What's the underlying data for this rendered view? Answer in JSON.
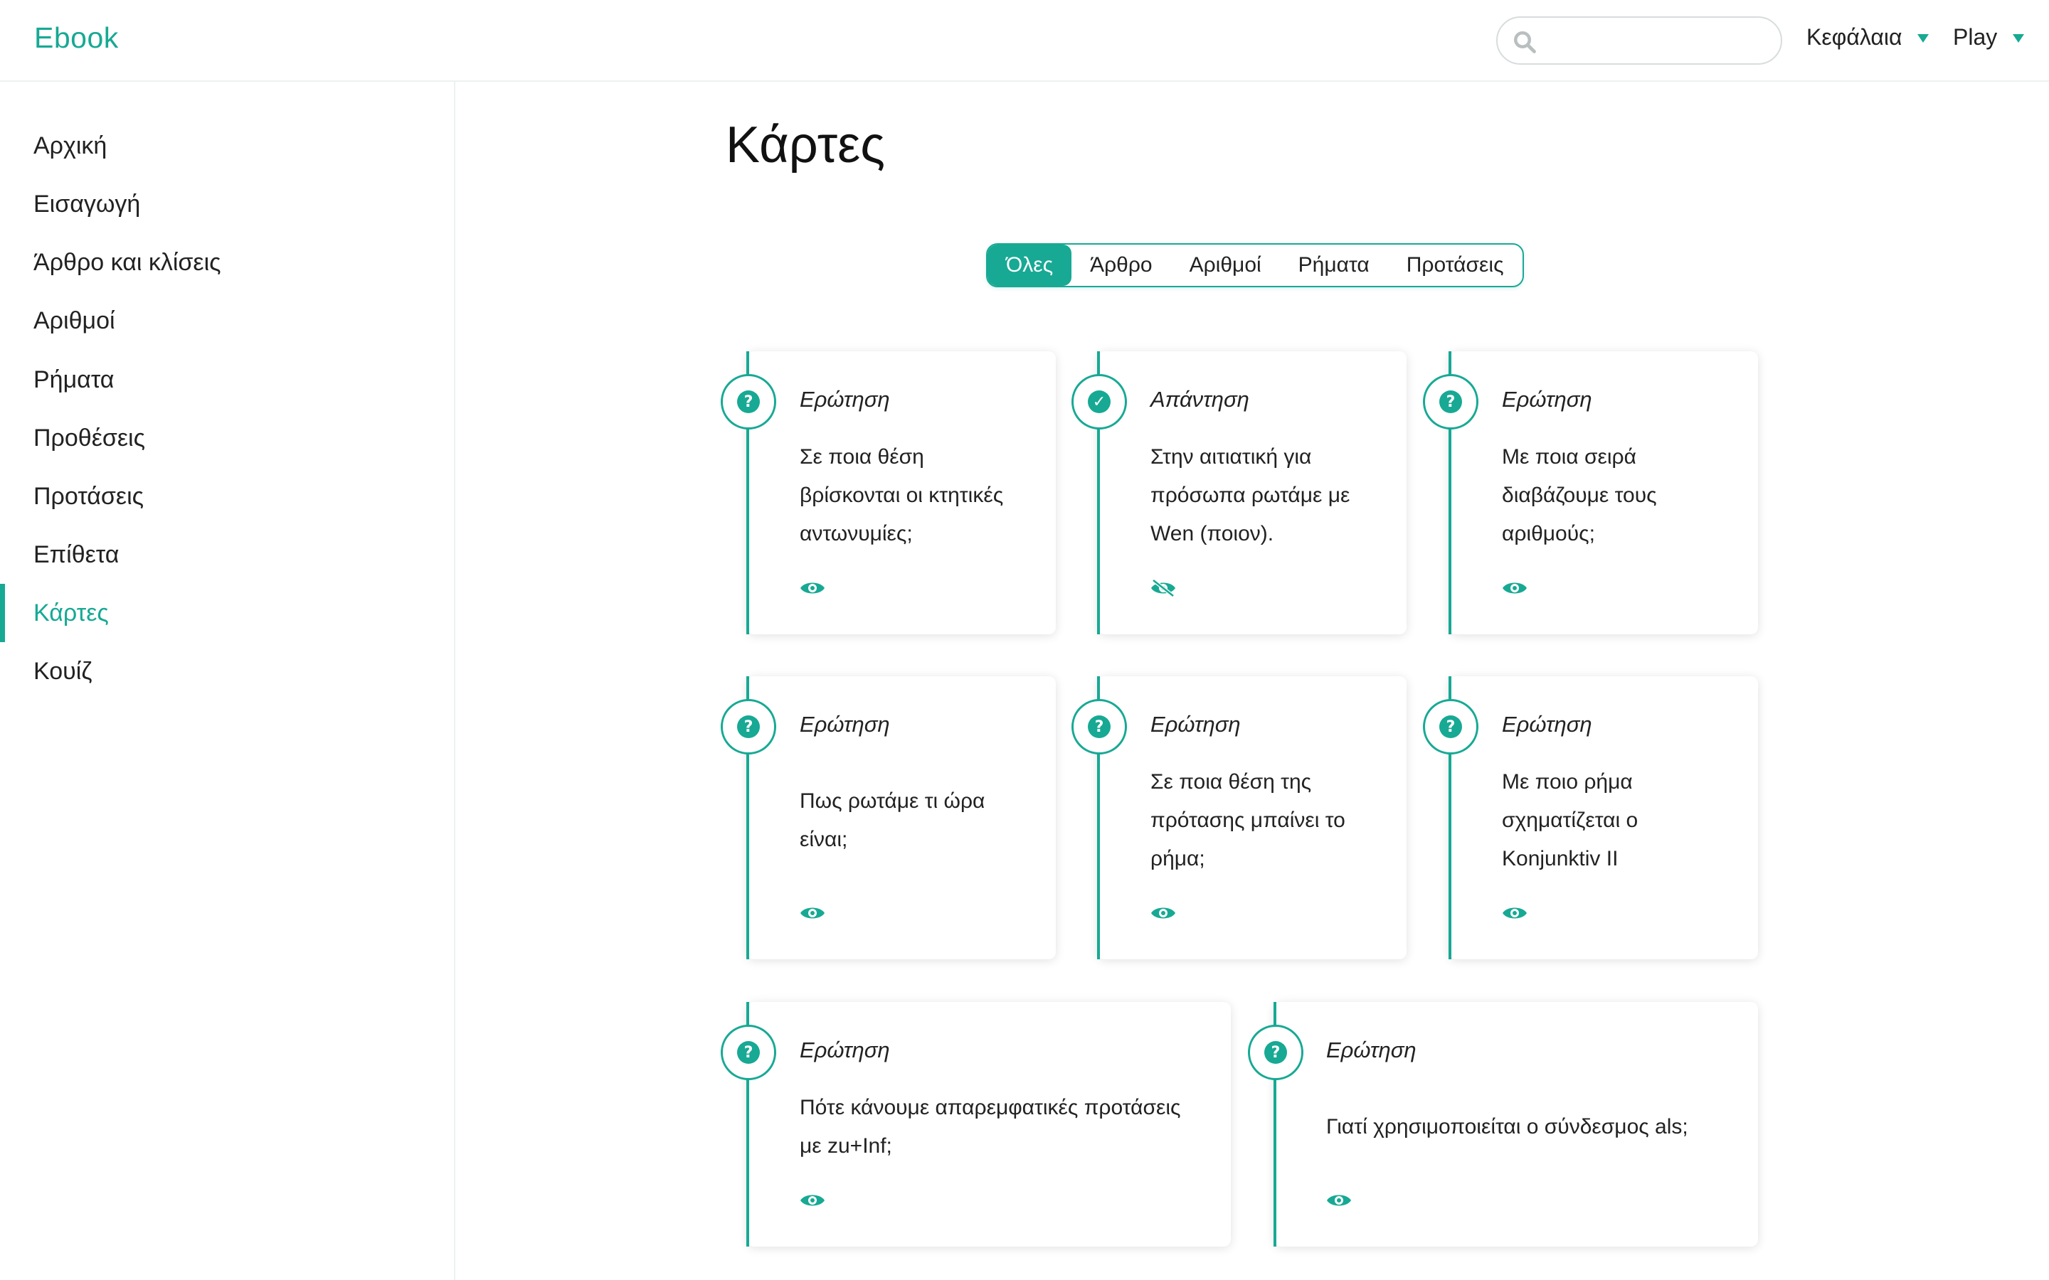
{
  "header": {
    "brand": "Ebook",
    "search_placeholder": "",
    "menu_chapters": "Κεφάλαια",
    "menu_play": "Play"
  },
  "sidebar": {
    "items": [
      {
        "label": "Αρχική"
      },
      {
        "label": "Εισαγωγή"
      },
      {
        "label": "Άρθρο και κλίσεις"
      },
      {
        "label": "Αριθμοί"
      },
      {
        "label": "Ρήματα"
      },
      {
        "label": "Προθέσεις"
      },
      {
        "label": "Προτάσεις"
      },
      {
        "label": "Επίθετα"
      },
      {
        "label": "Κάρτες"
      },
      {
        "label": "Κουίζ"
      }
    ],
    "active_index": 8
  },
  "main": {
    "title": "Κάρτες",
    "filters": [
      "Όλες",
      "Άρθρο",
      "Αριθμοί",
      "Ρήματα",
      "Προτάσεις"
    ],
    "active_filter": 0,
    "cards": [
      {
        "label": "Ερώτηση",
        "kind": "question",
        "text": "Σε ποια θέση βρίσκονται οι κτητικές αντωνυμίες;",
        "toggle": "eye-icon"
      },
      {
        "label": "Απάντηση",
        "kind": "answer",
        "text": "Στην αιτιατική για πρόσωπα ρωτάμε με Wen (ποιον).",
        "toggle": "eye-off-icon"
      },
      {
        "label": "Ερώτηση",
        "kind": "question",
        "text": "Με ποια σειρά διαβάζουμε τους αριθμούς;",
        "toggle": "eye-icon"
      },
      {
        "label": "Ερώτηση",
        "kind": "question",
        "text": "Πως ρωτάμε τι ώρα είναι;",
        "toggle": "eye-icon"
      },
      {
        "label": "Ερώτηση",
        "kind": "question",
        "text": "Σε ποια θέση της πρότασης μπαίνει το ρήμα;",
        "toggle": "eye-icon"
      },
      {
        "label": "Ερώτηση",
        "kind": "question",
        "text": "Με ποιο ρήμα σχηματίζεται ο Konjunktiv II",
        "toggle": "eye-icon"
      },
      {
        "label": "Ερώτηση",
        "kind": "question",
        "text": "Πότε κάνουμε απαρεμφατικές προτάσεις με zu+Inf;",
        "toggle": "eye-icon"
      },
      {
        "label": "Ερώτηση",
        "kind": "question",
        "text": "Γιατί χρησιμοποιείται ο σύνδεσμος als;",
        "toggle": "eye-icon"
      }
    ]
  },
  "colors": {
    "accent": "#17a994",
    "text": "#222222",
    "border": "#eef1f1"
  }
}
